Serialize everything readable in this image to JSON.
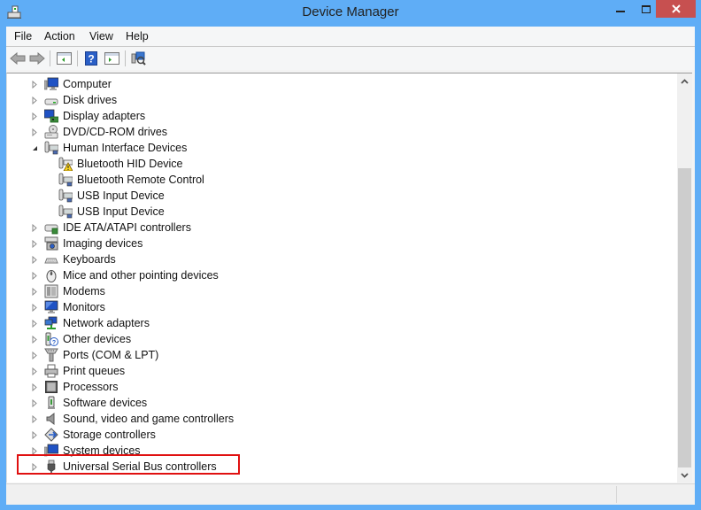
{
  "window": {
    "title": "Device Manager",
    "controls": {
      "minimize": "minimize",
      "maximize": "maximize",
      "close": "close"
    }
  },
  "menubar": {
    "items": [
      {
        "label": "File"
      },
      {
        "label": "Action"
      },
      {
        "label": "View"
      },
      {
        "label": "Help"
      }
    ]
  },
  "toolbar": {
    "buttons": [
      "back-icon",
      "forward-icon",
      "show-hide-console-tree-icon",
      "help-icon",
      "show-action-pane-icon",
      "scan-hardware-icon"
    ]
  },
  "tree": {
    "nodes": [
      {
        "label": "Computer",
        "icon": "computer-icon",
        "expanded": false,
        "level": 0
      },
      {
        "label": "Disk drives",
        "icon": "disk-drive-icon",
        "expanded": false,
        "level": 0
      },
      {
        "label": "Display adapters",
        "icon": "display-adapter-icon",
        "expanded": false,
        "level": 0
      },
      {
        "label": "DVD/CD-ROM drives",
        "icon": "dvd-drive-icon",
        "expanded": false,
        "level": 0
      },
      {
        "label": "Human Interface Devices",
        "icon": "hid-icon",
        "expanded": true,
        "level": 0
      },
      {
        "label": "Bluetooth HID Device",
        "icon": "hid-warning-icon",
        "level": 1,
        "warning": true
      },
      {
        "label": "Bluetooth Remote Control",
        "icon": "hid-icon",
        "level": 1
      },
      {
        "label": "USB Input Device",
        "icon": "hid-icon",
        "level": 1
      },
      {
        "label": "USB Input Device",
        "icon": "hid-icon",
        "level": 1
      },
      {
        "label": "IDE ATA/ATAPI controllers",
        "icon": "ide-controller-icon",
        "expanded": false,
        "level": 0
      },
      {
        "label": "Imaging devices",
        "icon": "imaging-device-icon",
        "expanded": false,
        "level": 0
      },
      {
        "label": "Keyboards",
        "icon": "keyboard-icon",
        "expanded": false,
        "level": 0
      },
      {
        "label": "Mice and other pointing devices",
        "icon": "mouse-icon",
        "expanded": false,
        "level": 0
      },
      {
        "label": "Modems",
        "icon": "modem-icon",
        "expanded": false,
        "level": 0
      },
      {
        "label": "Monitors",
        "icon": "monitor-icon",
        "expanded": false,
        "level": 0
      },
      {
        "label": "Network adapters",
        "icon": "network-adapter-icon",
        "expanded": false,
        "level": 0
      },
      {
        "label": "Other devices",
        "icon": "other-devices-icon",
        "expanded": false,
        "level": 0
      },
      {
        "label": "Ports (COM & LPT)",
        "icon": "port-icon",
        "expanded": false,
        "level": 0
      },
      {
        "label": "Print queues",
        "icon": "printer-icon",
        "expanded": false,
        "level": 0
      },
      {
        "label": "Processors",
        "icon": "processor-icon",
        "expanded": false,
        "level": 0
      },
      {
        "label": "Software devices",
        "icon": "software-device-icon",
        "expanded": false,
        "level": 0
      },
      {
        "label": "Sound, video and game controllers",
        "icon": "sound-icon",
        "expanded": false,
        "level": 0
      },
      {
        "label": "Storage controllers",
        "icon": "storage-controller-icon",
        "expanded": false,
        "level": 0
      },
      {
        "label": "System devices",
        "icon": "system-device-icon",
        "expanded": false,
        "level": 0
      },
      {
        "label": "Universal Serial Bus controllers",
        "icon": "usb-icon",
        "expanded": false,
        "level": 0,
        "highlighted": true
      }
    ]
  },
  "colors": {
    "titlebar": "#5fadf6",
    "close_button": "#c75050",
    "highlight_box": "#e01010"
  }
}
